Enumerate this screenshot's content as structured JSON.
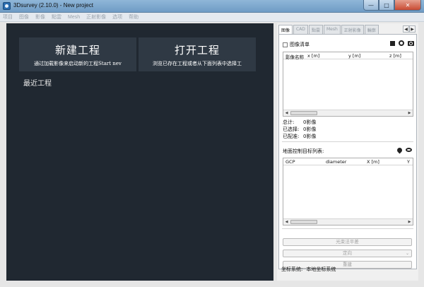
{
  "window": {
    "title": "3Dsurvey (2.10.0) - New project",
    "minimize_glyph": "—",
    "maximize_glyph": "□",
    "close_glyph": "✕"
  },
  "menu": [
    "项目",
    "图像",
    "影像",
    "點雲",
    "Mesh",
    "正射影像",
    "选项",
    "帮助"
  ],
  "start": {
    "new_project_title": "新建工程",
    "new_project_subtitle": "通过加载影像来启动新的工程Start nev",
    "open_project_title": "打开工程",
    "open_project_subtitle": "浏览已存在工程或者从下面列表中选择工",
    "recent_heading": "最近工程"
  },
  "tabs": [
    "图像",
    "CAD",
    "點雲",
    "Mesh",
    "正射影像",
    "輪廓"
  ],
  "tab_arrows": [
    "◀",
    "▶"
  ],
  "images": {
    "image_list_label": "图像清单",
    "columns": [
      "影像名称",
      "x [m]",
      "y [m]",
      "z [m]"
    ],
    "scroll_left": "◀",
    "scroll_right": "▶",
    "stats": [
      {
        "label": "总计:",
        "value": "0影像"
      },
      {
        "label": "已选择:",
        "value": "0影像"
      },
      {
        "label": "已配准:",
        "value": "0影像"
      }
    ]
  },
  "gcp": {
    "label": "地面控制目标列表:",
    "columns": [
      "GCP",
      "diameter",
      "X [m]",
      "Y"
    ]
  },
  "actions": {
    "bundle_adjust": "光束法平差",
    "orientation": "定向",
    "combo_arrow": "⌄",
    "rebuild": "重建"
  },
  "coordinate_system": {
    "label": "坐标系统:",
    "value": "本地坐标系统"
  },
  "icons": [
    "app-icon",
    "add-image-icon",
    "target-icon",
    "camera-icon",
    "pin-icon",
    "eye-icon"
  ],
  "colors": {
    "dark_panel": "#202831",
    "start_button": "#2f3944",
    "title_bar": "#7fa9cf"
  }
}
